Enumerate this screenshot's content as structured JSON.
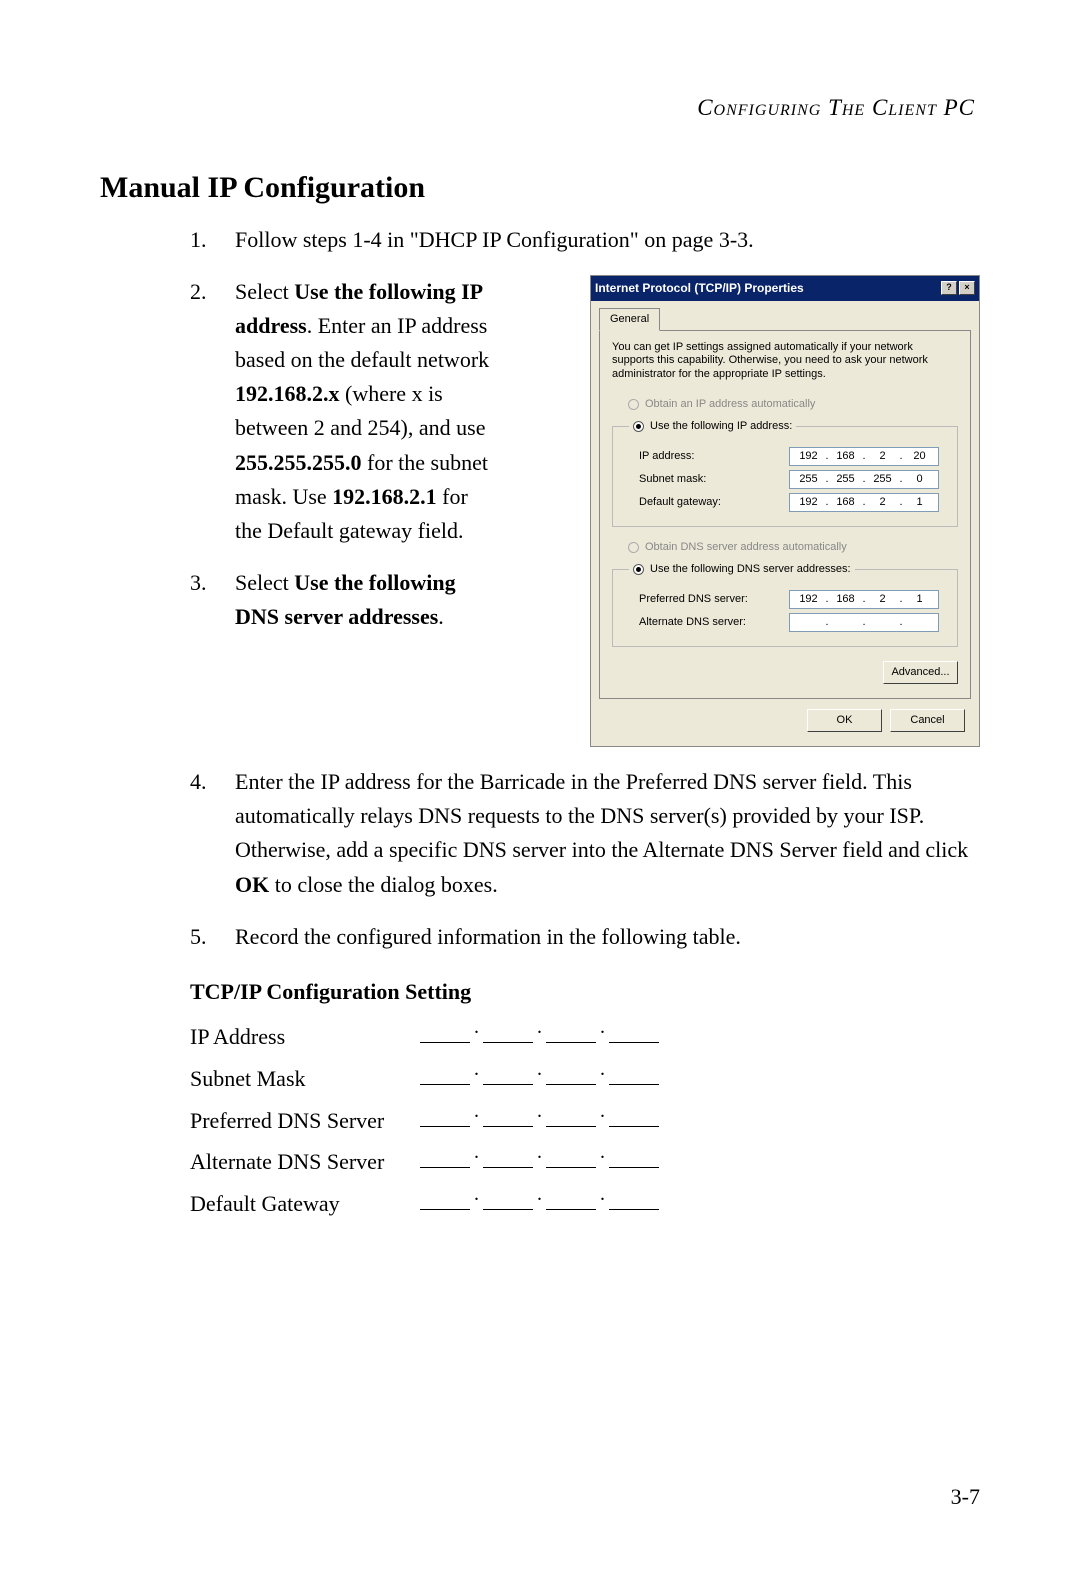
{
  "header": "Configuring The Client PC",
  "heading": "Manual IP Configuration",
  "page_number": "3-7",
  "steps": {
    "s1": "Follow steps 1-4 in \"DHCP IP Configuration\" on page 3-3.",
    "s2_a": "Select ",
    "s2_b": "Use the following IP address",
    "s2_c": ". Enter an IP address based on the default network ",
    "s2_d": "192.168.2.x",
    "s2_e": " (where x is between 2 and 254), and use ",
    "s2_f": "255.255.255.0",
    "s2_g": " for the subnet mask. Use ",
    "s2_h": "192.168.2.1",
    "s2_i": " for the Default gateway field.",
    "s3_a": "Select ",
    "s3_b": "Use the following DNS server addresses",
    "s3_c": ".",
    "s4_a": "Enter the IP address for the Barricade in the Preferred DNS server field. This automatically relays DNS requests to the DNS server(s) provided by your ISP. Otherwise, add a specific DNS server into the Alternate DNS Server field and click ",
    "s4_b": "OK",
    "s4_c": " to close the dialog boxes.",
    "s5": "Record the configured information in the following table."
  },
  "dialog": {
    "title": "Internet Protocol (TCP/IP) Properties",
    "help": "?",
    "close": "×",
    "tab": "General",
    "info": "You can get IP settings assigned automatically if your network supports this capability. Otherwise, you need to ask your network administrator for the appropriate IP settings.",
    "radio_auto_ip": "Obtain an IP address automatically",
    "radio_use_ip": "Use the following IP address:",
    "label_ip": "IP address:",
    "label_subnet": "Subnet mask:",
    "label_gateway": "Default gateway:",
    "radio_auto_dns": "Obtain DNS server address automatically",
    "radio_use_dns": "Use the following DNS server addresses:",
    "label_pref_dns": "Preferred DNS server:",
    "label_alt_dns": "Alternate DNS server:",
    "btn_advanced": "Advanced...",
    "btn_ok": "OK",
    "btn_cancel": "Cancel",
    "ip": {
      "a": "192",
      "b": "168",
      "c": "2",
      "d": "20"
    },
    "subnet": {
      "a": "255",
      "b": "255",
      "c": "255",
      "d": "0"
    },
    "gateway": {
      "a": "192",
      "b": "168",
      "c": "2",
      "d": "1"
    },
    "pref": {
      "a": "192",
      "b": "168",
      "c": "2",
      "d": "1"
    },
    "alt": {
      "a": "",
      "b": "",
      "c": "",
      "d": ""
    }
  },
  "table": {
    "title": "TCP/IP Configuration Setting",
    "rows": {
      "ip": "IP Address",
      "subnet": "Subnet Mask",
      "pref": "Preferred DNS Server",
      "alt": "Alternate DNS Server",
      "gw": "Default Gateway"
    }
  }
}
